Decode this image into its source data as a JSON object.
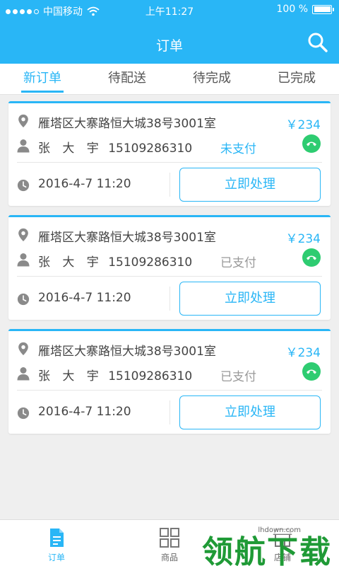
{
  "status_bar": {
    "carrier": "中国移动",
    "time": "上午11:27",
    "battery": "100 %"
  },
  "nav": {
    "title": "订单",
    "search_icon": "search-icon"
  },
  "tabs": [
    {
      "label": "新订单",
      "active": true
    },
    {
      "label": "待配送",
      "active": false
    },
    {
      "label": "待完成",
      "active": false
    },
    {
      "label": "已完成",
      "active": false
    }
  ],
  "orders": [
    {
      "address": "雁塔区大寨路恒大城38号3001室",
      "price": "￥234",
      "name": "张 大 宇",
      "phone": "15109286310",
      "pay_status": "未支付",
      "paid": false,
      "time": "2016-4-7  11:20",
      "action_label": "立即处理"
    },
    {
      "address": "雁塔区大寨路恒大城38号3001室",
      "price": "￥234",
      "name": "张 大 宇",
      "phone": "15109286310",
      "pay_status": "已支付",
      "paid": true,
      "time": "2016-4-7  11:20",
      "action_label": "立即处理"
    },
    {
      "address": "雁塔区大寨路恒大城38号3001室",
      "price": "￥234",
      "name": "张 大 宇",
      "phone": "15109286310",
      "pay_status": "已支付",
      "paid": true,
      "time": "2016-4-7  11:20",
      "action_label": "立即处理"
    }
  ],
  "bottom_nav": [
    {
      "label": "订单",
      "icon": "document-icon",
      "active": true
    },
    {
      "label": "商品",
      "icon": "grid-icon",
      "active": false
    },
    {
      "label": "店铺",
      "icon": "store-icon",
      "active": false
    }
  ],
  "watermark": {
    "text": "领航下载",
    "url": "lhdown.com"
  },
  "colors": {
    "accent": "#29b6f6",
    "call": "#2ecc71",
    "background": "#efefef"
  }
}
